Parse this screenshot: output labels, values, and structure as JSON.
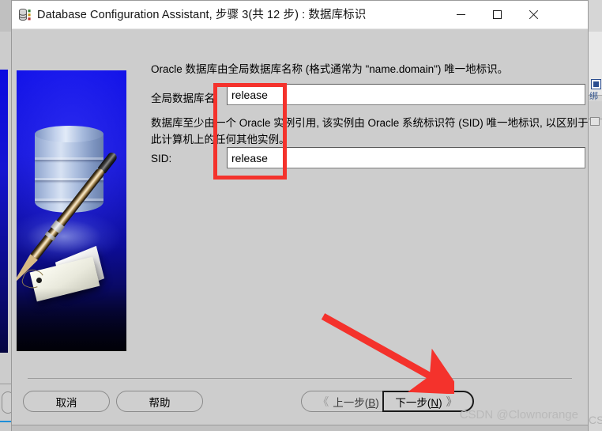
{
  "window": {
    "title": "Database Configuration Assistant, 步骤 3(共 12 步) : 数据库标识",
    "icon": "database-icon",
    "controls": {
      "minimize": "minimize-icon",
      "maximize": "maximize-icon",
      "close": "close-icon"
    }
  },
  "illustration": {
    "alt": "database-cylinder-pen-tag-illustration"
  },
  "content": {
    "paragraph1": "Oracle 数据库由全局数据库名称 (格式通常为 \"name.domain\") 唯一地标识。",
    "paragraph2": "数据库至少由一个 Oracle 实例引用, 该实例由 Oracle 系统标识符 (SID) 唯一地标识, 以区别于此计算机上的任何其他实例。",
    "global_db_label": "全局数据库名:",
    "global_db_value": "release",
    "sid_label": "SID:",
    "sid_value": "release"
  },
  "buttons": {
    "cancel": "取消",
    "help": "帮助",
    "prev_chevron": "《",
    "prev_label_pre": "上一步(",
    "prev_label_key": "B",
    "prev_label_post": ")",
    "next_label_pre": "下一步(",
    "next_label_key": "N",
    "next_label_post": ")",
    "next_chevron": "》"
  },
  "annotations": {
    "highlight_box": "red-rectangle-around-field-left-edges",
    "arrow": "red-arrow-pointing-to-next-button",
    "accent_color": "#f4322c"
  },
  "watermark": {
    "text": "CSDN @Clownorange"
  },
  "background_window": {
    "right_label": "绑"
  }
}
